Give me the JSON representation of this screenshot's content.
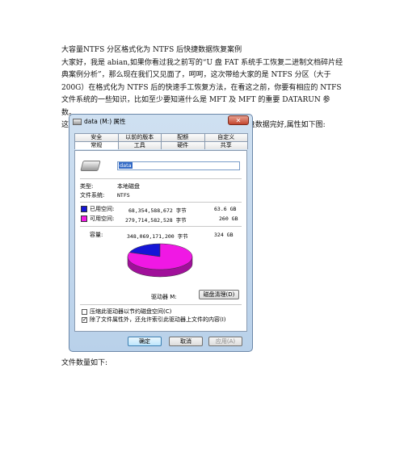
{
  "article": {
    "heading": "大容量NTFS 分区格式化为 NTFS 后快捷数据恢复案例",
    "intro": "大家好，我是 abian,如果你看过我之前写的“U 盘 FAT 系统手工恢复二进制文档碎片经典案例分析”，那么现在我们又见面了，呵呵，这次带给大家的是 NTFS 分区（大于 200G）在格式化为 NTFS 后的快速手工恢复方法，在看这之前，你要有相应的 NTFS 文件系统的一些知识，比如至少要知道什么是 MFT 及 MFT 的重要 DATARUN 参数。",
    "lead": "这次拿我的盘来给大家做小白呀,哈哈.首先大家请看我的原盘数据完好,属性如下图:",
    "caption": "文件数量如下:"
  },
  "dialog": {
    "title": "data (M:) 属性",
    "close_glyph": "✕",
    "tabs_row1": [
      "安全",
      "以前的版本",
      "配额",
      "自定义"
    ],
    "tabs_row2": [
      "常规",
      "工具",
      "硬件",
      "共享"
    ],
    "volume_label": "data",
    "type_label": "类型:",
    "type_value": "本地磁盘",
    "fs_label": "文件系统:",
    "fs_value": "NTFS",
    "used_label": "已用空间:",
    "used_bytes": "68,354,588,672 字节",
    "used_gb": "63.6 GB",
    "free_label": "可用空间:",
    "free_bytes": "279,714,582,528 字节",
    "free_gb": "260 GB",
    "capacity_label": "容量:",
    "capacity_bytes": "348,069,171,200 字节",
    "capacity_gb": "324 GB",
    "drive_label": "驱动器 M:",
    "cleanup_button": "磁盘清理(D)",
    "compress_label": "压缩此驱动器以节约磁盘空间(C)",
    "index_label": "除了文件属性外，还允许索引此驱动器上文件的内容(I)",
    "ok_button": "确定",
    "cancel_button": "取消",
    "apply_button": "应用(A)"
  },
  "colors": {
    "used": "#1515d6",
    "free": "#f018e4"
  },
  "chart_data": {
    "type": "pie",
    "categories": [
      "已用空间",
      "可用空间"
    ],
    "values": [
      63.6,
      260
    ]
  }
}
